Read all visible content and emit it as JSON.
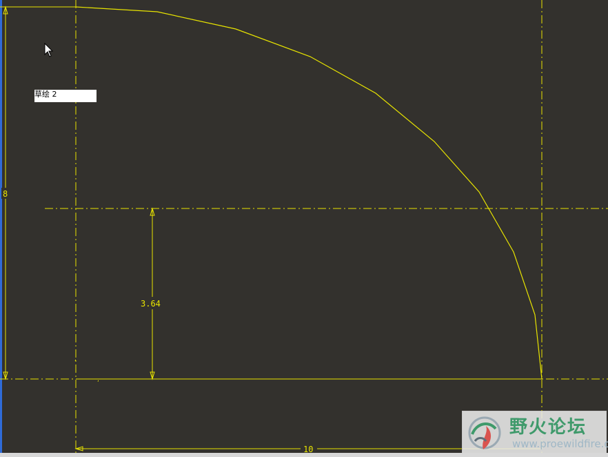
{
  "sketch": {
    "tooltip": {
      "title": "草绘 2",
      "subtitle": "- . - . - . -"
    },
    "dimensions": {
      "height": "8",
      "offset": "3.64",
      "width": "10"
    },
    "colors": {
      "background": "#33312d",
      "geometry": "#e8e400",
      "left_border": "#2f6bd8"
    }
  },
  "watermark": {
    "title": "野火论坛",
    "url": "www.proewildfire.cn"
  },
  "cursor": {
    "icon": "arrow-cursor-icon"
  }
}
